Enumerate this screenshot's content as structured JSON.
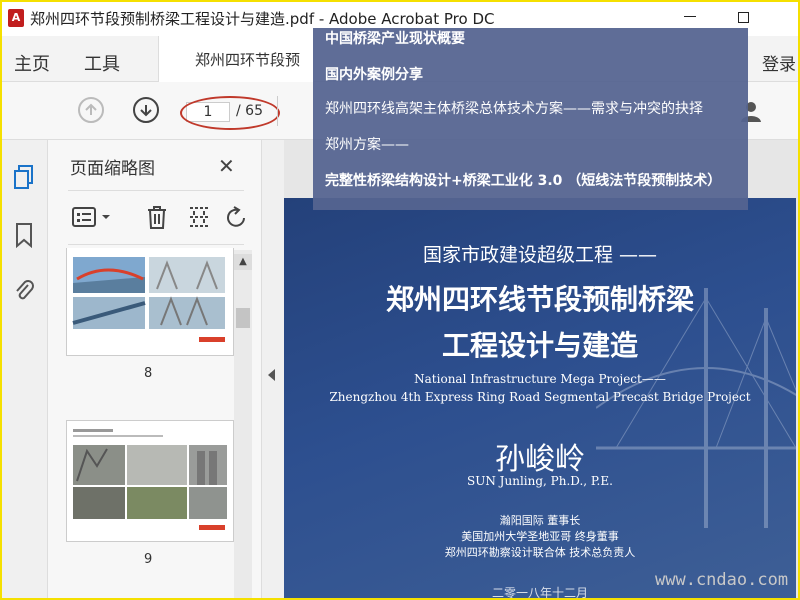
{
  "window": {
    "title": "郑州四环节段预制桥梁工程设计与建造.pdf - Adobe Acrobat Pro DC"
  },
  "menu": {
    "home": "主页",
    "tools": "工具",
    "doc_tab": "郑州四环节段预",
    "login": "登录"
  },
  "toolbar": {
    "current_page": "1",
    "total_pages": "/ 65"
  },
  "panel": {
    "title": "页面缩略图",
    "thumbnails": [
      {
        "page": "8"
      },
      {
        "page": "9"
      }
    ]
  },
  "popup": {
    "lines": [
      "中国桥梁产业现状概要",
      "国内外案例分享",
      "郑州四环线高架主体桥梁总体技术方案——需求与冲突的抉择",
      "郑州方案——",
      "完整性桥梁结构设计+桥梁工业化 3.0 （短线法节段预制技术）"
    ]
  },
  "slide": {
    "subtitle": "国家市政建设超级工程 ——",
    "title_line1": "郑州四环线节段预制桥梁",
    "title_line2": "工程设计与建造",
    "en_line1": "National Infrastructure Mega Project——",
    "en_line2": "Zhengzhou 4th Express Ring Road Segmental Precast Bridge Project",
    "author": "孙峻岭",
    "author_en": "SUN Junling, Ph.D., P.E.",
    "role1": "瀚阳国际 董事长",
    "role2": "美国加州大学圣地亚哥 终身董事",
    "role3": "郑州四环勘察设计联合体 技术总负责人",
    "footer": "二零一八年十二月"
  },
  "watermark": "www.cndao.com",
  "colors": {
    "slide_bg": "#2d4f8f",
    "popup_bg": "#556491",
    "annotation": "#c0392b",
    "frame": "#f5e000"
  }
}
